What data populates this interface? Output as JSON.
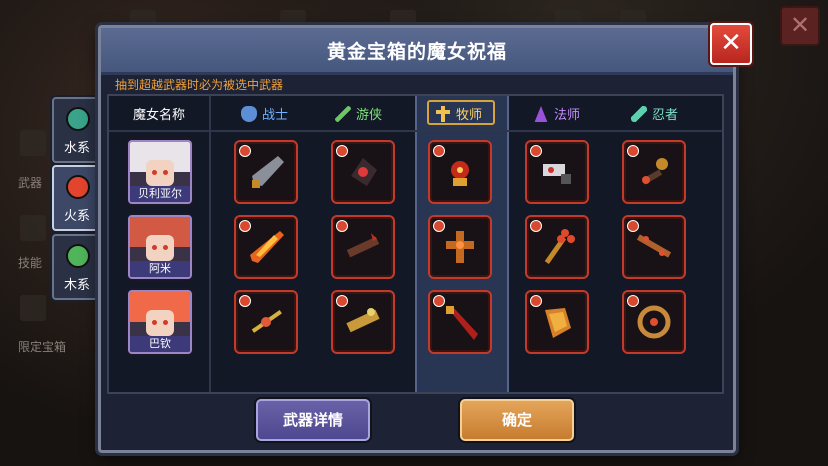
{
  "dialog": {
    "title": "黄金宝箱的魔女祝福",
    "notice": "抽到超越武器时必为被选中武器",
    "close_symbol": "✕"
  },
  "background": {
    "side_labels": [
      "武器",
      "技能",
      "限定宝箱"
    ],
    "close_symbol": "✕"
  },
  "element_tabs": [
    {
      "label": "水系",
      "gem_color": "#3aa38a",
      "active": false
    },
    {
      "label": "火系",
      "gem_color": "#e2442e",
      "active": true
    },
    {
      "label": "木系",
      "gem_color": "#4fb45a",
      "active": false
    }
  ],
  "table": {
    "name_header": "魔女名称",
    "classes": [
      {
        "label": "战士",
        "icon": "shield-icon",
        "color": "#6fb2ff"
      },
      {
        "label": "游侠",
        "icon": "bow-icon",
        "color": "#7fe07a"
      },
      {
        "label": "牧师",
        "icon": "cross-icon",
        "color": "#ffd36a",
        "selected": true
      },
      {
        "label": "法师",
        "icon": "wizard-hat-icon",
        "color": "#c68cff"
      },
      {
        "label": "忍者",
        "icon": "shuriken-icon",
        "color": "#7fe0c8"
      }
    ],
    "witches": [
      {
        "name": "贝利亚尔",
        "hair_color": "#e8e4ea"
      },
      {
        "name": "阿米",
        "hair_color": "#d25a44"
      },
      {
        "name": "巴钦",
        "hair_color": "#f06a4a"
      }
    ],
    "weapons": [
      [
        "spear-tip-icon",
        "claw-icon",
        "lamp-icon",
        "bone-crossbow-icon",
        "flail-icon"
      ],
      [
        "flame-sword-icon",
        "thorn-crossbow-icon",
        "fire-cross-icon",
        "orb-staff-icon",
        "chain-blade-icon"
      ],
      [
        "gold-staff-icon",
        "gold-crossbow-icon",
        "crimson-sword-icon",
        "gauntlet-icon",
        "ring-blade-icon"
      ]
    ]
  },
  "buttons": {
    "details": "武器详情",
    "confirm": "确定"
  },
  "colors": {
    "panel": "#1d2334",
    "title_bar": "#4f6088",
    "weapon_border": "#c23a2a",
    "notice": "#f0a03a",
    "highlight_column": "#283553"
  }
}
